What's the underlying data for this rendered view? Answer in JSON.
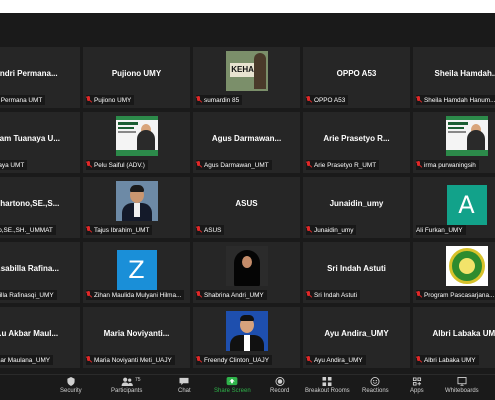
{
  "participants": [
    {
      "name": "andri Permana...",
      "label": "Andri Permana UMT"
    },
    {
      "name": "Pujiono UMY",
      "label": "Pujiono UMY"
    },
    {
      "name": "",
      "label": "sumardin 85",
      "thumb": "kehan-photo",
      "thumb_text": "KEHAN"
    },
    {
      "name": "OPPO A53",
      "label": "OPPO A53"
    },
    {
      "name": "Sheila Hamdah...",
      "label": "Sheila Hamdah Hanum..."
    },
    {
      "name": "Mam Tuanaya U...",
      "label": "Tuanaya UMT"
    },
    {
      "name": "",
      "label": "Pelu Saiful (ADV.)",
      "thumb": "webinar-poster"
    },
    {
      "name": "Agus Darmawan...",
      "label": "Agus Darmawan_UMT"
    },
    {
      "name": "Arie Prasetyo R...",
      "label": "Arie Prasetyo R_UMT"
    },
    {
      "name": "",
      "label": "irma purwaningsih",
      "thumb": "webinar-poster"
    },
    {
      "name": "...hartono,SE.,S...",
      "label": "...tono,SE.,SH._UMMAT"
    },
    {
      "name": "",
      "label": "Tajus Ibrahim_UMT",
      "thumb": "man-photo"
    },
    {
      "name": "ASUS",
      "label": "ASUS"
    },
    {
      "name": "Junaidin_umy",
      "label": "Junaidin_umy"
    },
    {
      "name": "",
      "label": "Ali Furkan_UMY",
      "avatar_letter": "A",
      "avatar_color": "#12a28a",
      "no_mic": true
    },
    {
      "name": "...sabilla Rafina...",
      "label": "...sabilla Rafinasqi_UMY"
    },
    {
      "name": "",
      "label": "Zihan Maulida Mulyani Hilma...",
      "avatar_letter": "Z",
      "avatar_color": "#1a8fd8"
    },
    {
      "name": "",
      "label": "Shabrina Andri_UMY",
      "thumb": "hijab-photo"
    },
    {
      "name": "Sri Indah Astuti",
      "label": "Sri Indah Astuti"
    },
    {
      "name": "",
      "label": "Program Pascasarjana...",
      "thumb": "seal-logo"
    },
    {
      "name": "...u Akbar Maul...",
      "label": "...Akbar Maulana_UMY"
    },
    {
      "name": "Maria Noviyanti...",
      "label": "Maria Noviyanti Meti_UAJY"
    },
    {
      "name": "",
      "label": "Freendy Clinton_UAJY",
      "thumb": "formal-photo"
    },
    {
      "name": "Ayu Andira_UMY",
      "label": "Ayu Andira_UMY"
    },
    {
      "name": "Albri Labaka UMY",
      "label": "Albri Labaka UMY"
    }
  ],
  "poster": {
    "line1": "WEBINAR",
    "line2": "INTERNATIONAL"
  },
  "toolbar": {
    "security": "Security",
    "participants": "Participants",
    "participants_count": "75",
    "chat": "Chat",
    "share": "Share Screen",
    "record": "Record",
    "breakout": "Breakout Rooms",
    "reactions": "Reactions",
    "apps": "Apps",
    "whiteboards": "Whiteboards"
  },
  "colors": {
    "share_green": "#2fb34a",
    "muted_red": "#e02828",
    "tile_bg": "#262626"
  }
}
